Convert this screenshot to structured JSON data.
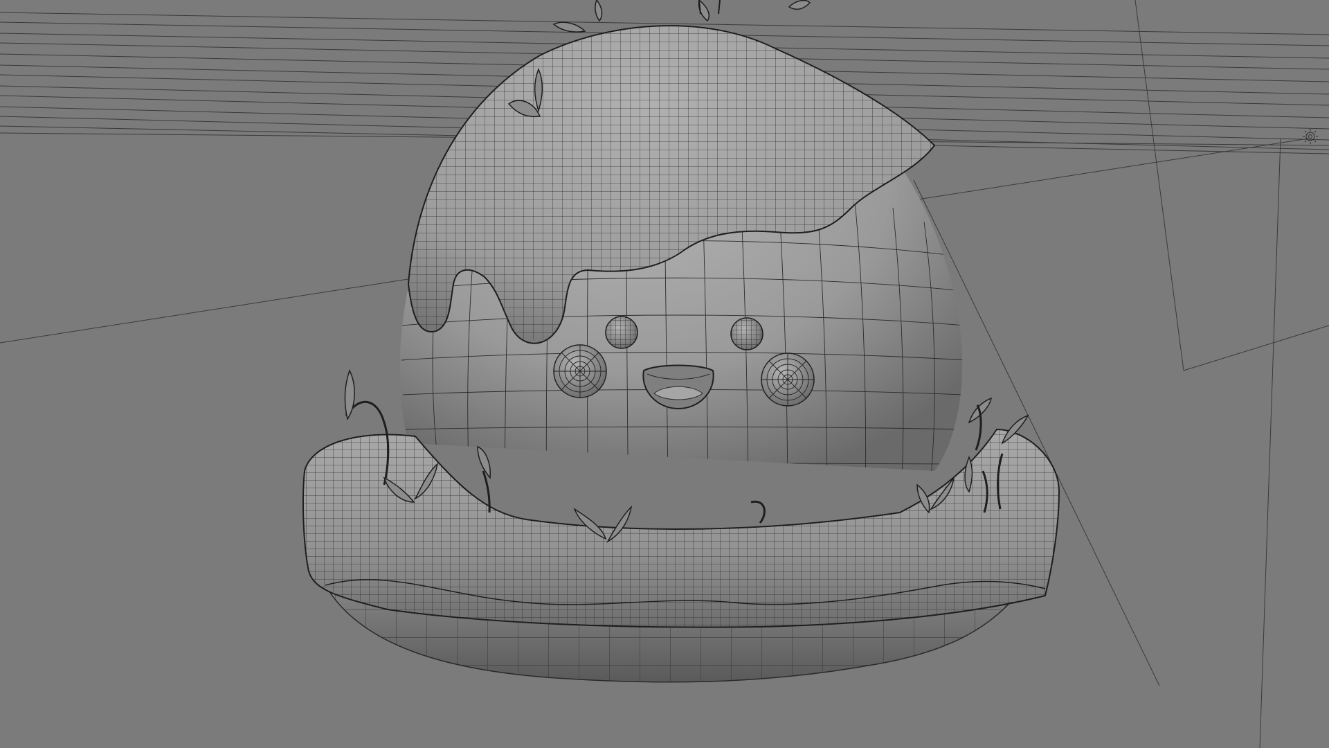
{
  "viewport": {
    "background": "#7b7b7b",
    "mesh_line_color": "#2a2a2a",
    "model_shade_light": "#a6a6a6",
    "model_shade_dark": "#5c5c5c",
    "grid_line_color": "#3a3a3a"
  },
  "scene": {
    "objects": [
      {
        "name": "dome-body",
        "kind": "wireframe-mesh"
      },
      {
        "name": "icing-cap",
        "kind": "wireframe-mesh"
      },
      {
        "name": "base-ring",
        "kind": "wireframe-mesh"
      },
      {
        "name": "sprouts",
        "kind": "wireframe-mesh"
      },
      {
        "name": "eyes",
        "kind": "wireframe-mesh"
      },
      {
        "name": "cheeks",
        "kind": "wireframe-mesh"
      },
      {
        "name": "mouth",
        "kind": "wireframe-mesh"
      }
    ],
    "light_gizmo_icon": "sun-light-icon"
  }
}
